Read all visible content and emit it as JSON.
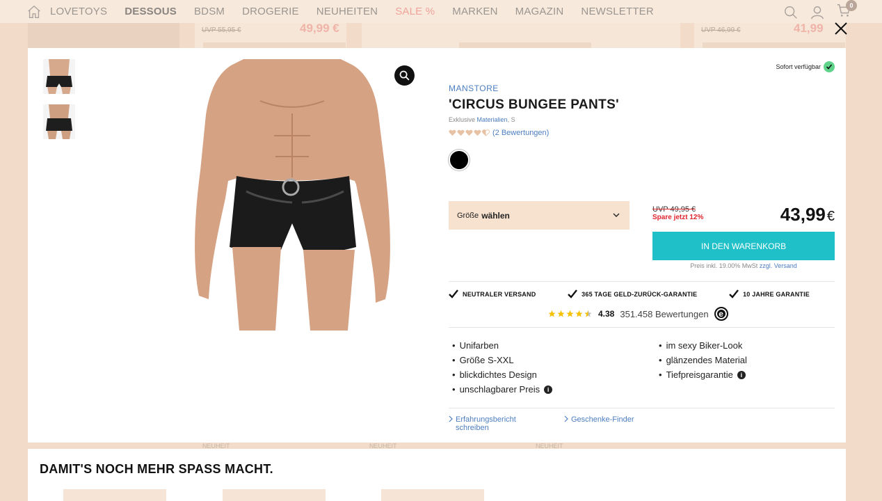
{
  "nav": {
    "items": [
      "LOVETOYS",
      "DESSOUS",
      "BDSM",
      "DROGERIE",
      "NEUHEITEN",
      "SALE %",
      "MARKEN",
      "MAGAZIN",
      "NEWSLETTER"
    ],
    "active": "DESSOUS",
    "cart_count": "0"
  },
  "background": {
    "cards": [
      {
        "uvp": "UVP 55,95 €",
        "price": "49,99 €"
      },
      {
        "uvp": "UVP 46,99 €",
        "price": "41,99"
      }
    ],
    "neuheit": [
      "NEUHEIT",
      "NEUHEIT",
      "NEUHEIT"
    ]
  },
  "product": {
    "availability": "Sofort verfügbar",
    "brand": "MANSTORE",
    "title": "'CIRCUS BUNGEE PANTS'",
    "subtitle_prefix": "Exklusive",
    "subtitle_link": "Materialien",
    "subtitle_suffix": ", S",
    "rating_value": 4.5,
    "rating_text": "(2 Bewertungen)",
    "color_selected": "#000000",
    "size_label": "Größe",
    "size_value": "wählen",
    "uvp": "UVP 49,95 €",
    "save": "Spare jetzt 12%",
    "price": "43,99",
    "currency": "€",
    "cart_button": "IN DEN WARENKORB",
    "tax_text": "Preis inkl. 19.00% MwSt",
    "tax_link": "zzgl. Versand"
  },
  "guarantees": [
    "NEUTRALER VERSAND",
    "365 TAGE GELD-ZURÜCK-GARANTIE",
    "10 JAHRE GARANTIE"
  ],
  "trust": {
    "stars": 4.5,
    "score": "4.38",
    "reviews": "351.458 Bewertungen",
    "emblem": "e"
  },
  "features": {
    "left": [
      "Unifarben",
      "Größe S-XXL",
      "blickdichtes Design",
      "unschlagbarer Preis"
    ],
    "right": [
      "im sexy Biker-Look",
      "glänzendes Material",
      "Tiefpreisgarantie"
    ]
  },
  "links": [
    "Erfahrungsbericht schreiben",
    "Geschenke-Finder"
  ],
  "bottom": {
    "heading": "DAMIT'S NOCH MEHR SPASS MACHT."
  },
  "colors": {
    "accent": "#20c0c8",
    "link": "#4c7ec0",
    "sale": "#e0242d",
    "page_bg": "#f2dcc9"
  }
}
